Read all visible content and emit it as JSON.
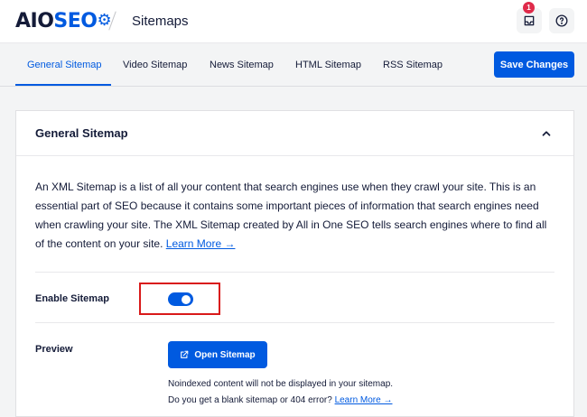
{
  "header": {
    "logo_aio": "AIO",
    "logo_seo": "SEO",
    "breadcrumb": "Sitemaps",
    "notifications_count": "1",
    "icons": {
      "notifications": "inbox-icon",
      "help": "help-circle-icon",
      "logo_gear": "gear-icon"
    }
  },
  "tabs": [
    {
      "label": "General Sitemap",
      "active": true
    },
    {
      "label": "Video Sitemap"
    },
    {
      "label": "News Sitemap"
    },
    {
      "label": "HTML Sitemap"
    },
    {
      "label": "RSS Sitemap"
    }
  ],
  "toolbar": {
    "save_label": "Save Changes"
  },
  "card": {
    "title": "General Sitemap",
    "description": "An XML Sitemap is a list of all your content that search engines use when they crawl your site. This is an essential part of SEO because it contains some important pieces of information that search engines need when crawling your site. The XML Sitemap created by All in One SEO tells search engines where to find all of the content on your site.",
    "learn_more": "Learn More →",
    "enable_label": "Enable Sitemap",
    "enable_on": true,
    "preview_label": "Preview",
    "open_button": "Open Sitemap",
    "note1": "Noindexed content will not be displayed in your sitemap.",
    "note2_text": "Do you get a blank sitemap or 404 error?",
    "note2_link": "Learn More →"
  },
  "colors": {
    "accent": "#005ae0",
    "highlight": "#d91a1a",
    "badge": "#df2a4a"
  }
}
